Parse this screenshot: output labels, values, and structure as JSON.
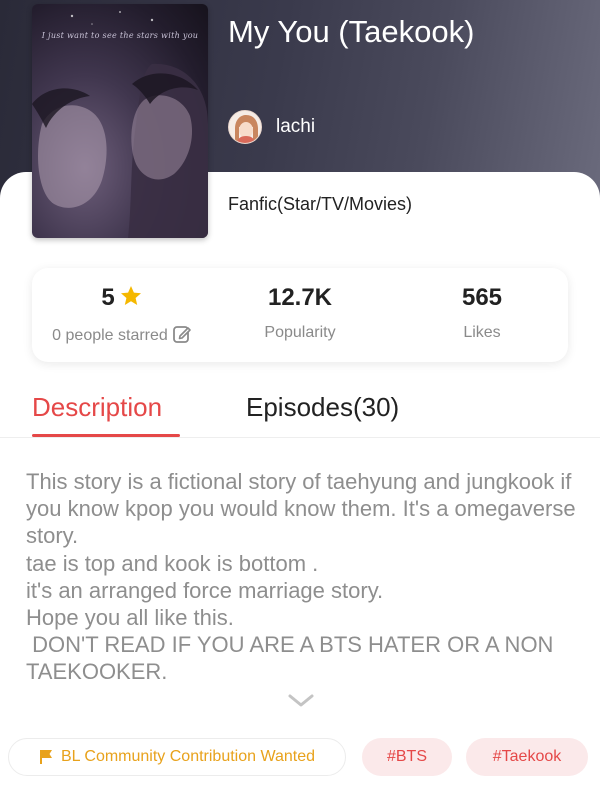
{
  "story": {
    "title": "My You (Taekook)",
    "author": "lachi",
    "genre": "Fanfic(Star/TV/Movies)",
    "cover_caption": "I just want to see the stars with you"
  },
  "stats": {
    "rating": "5",
    "rating_label": "0 people starred",
    "popularity": "12.7K",
    "popularity_label": "Popularity",
    "likes": "565",
    "likes_label": "Likes"
  },
  "tabs": {
    "description": "Description",
    "episodes": "Episodes(30)",
    "active": "description"
  },
  "description_text": "This story is a fictional story of taehyung and jungkook if you know kpop you would know them. It's a omegaverse story.\ntae is top and kook is bottom .\nit's an arranged force marriage story.\nHope you all like this.\n DON'T READ IF YOU ARE A BTS HATER OR A NON TAEKOOKER.",
  "tags": {
    "community": "BL Community Contribution Wanted",
    "tag1": "#BTS",
    "tag2": "#Taekook"
  },
  "icons": {
    "star": "star-icon",
    "edit": "edit-icon",
    "chevron": "chevron-down-icon",
    "flag": "flag-icon"
  },
  "colors": {
    "accent": "#e54848",
    "star": "#f5b800",
    "community": "#e8a21c",
    "tag_bg": "#fbe9ea"
  }
}
